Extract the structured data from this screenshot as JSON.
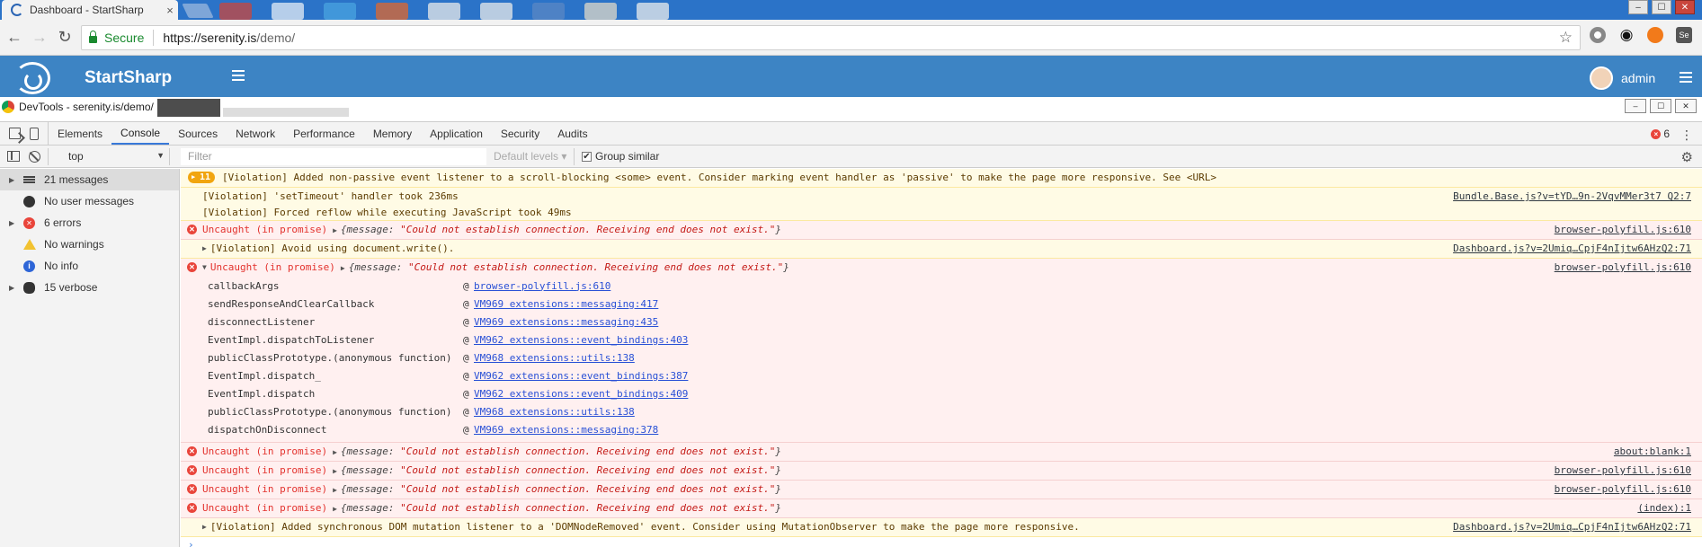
{
  "browser": {
    "tab_title": "Dashboard - StartSharp",
    "tab_close": "×",
    "url_secure": "Secure",
    "url_host": "https://serenity.is",
    "url_path": "/demo/",
    "bookmark_icon": "star-icon",
    "window_controls": [
      "‒",
      "☐",
      "✕"
    ]
  },
  "app": {
    "brand": "StartSharp",
    "user": "admin",
    "brand_color": "#3d84c4"
  },
  "devtools": {
    "title": "DevTools - serenity.is/demo/",
    "tabs": [
      "Elements",
      "Console",
      "Sources",
      "Network",
      "Performance",
      "Memory",
      "Application",
      "Security",
      "Audits"
    ],
    "active_tab": "Console",
    "error_count": "6",
    "context": "top",
    "filter_placeholder": "Filter",
    "levels": "Default levels ▾",
    "group_similar": "Group similar",
    "group_similar_checked": "✔"
  },
  "sidebar": {
    "items": [
      {
        "label": "21 messages",
        "icon": "list-icon",
        "expandable": true
      },
      {
        "label": "No user messages",
        "icon": "user-icon",
        "expandable": false
      },
      {
        "label": "6 errors",
        "icon": "error-icon",
        "expandable": true
      },
      {
        "label": "No warnings",
        "icon": "warning-icon",
        "expandable": false
      },
      {
        "label": "No info",
        "icon": "info-icon",
        "expandable": false
      },
      {
        "label": "15 verbose",
        "icon": "bug-icon",
        "expandable": true
      }
    ]
  },
  "console": {
    "m1": {
      "badge": "11",
      "text": "[Violation] Added non-passive event listener to a scroll-blocking <some> event. Consider marking event handler as 'passive' to make the page more responsive. See <URL>"
    },
    "m2": {
      "text": "[Violation] 'setTimeout' handler took 236ms",
      "src": "Bundle.Base.js?v=tYD…9n-2VqvMMer3t7 Q2:7"
    },
    "m3": {
      "text": "[Violation] Forced reflow while executing JavaScript took 49ms"
    },
    "m4": {
      "label": "Uncaught (in promise)",
      "obj_key": "{message: ",
      "obj_val": "\"Could not establish connection. Receiving end does not exist.\"",
      "obj_end": "}",
      "src": "browser-polyfill.js:610"
    },
    "m5": {
      "text": "[Violation] Avoid using document.write().",
      "src": "Dashboard.js?v=2Umiq…CpjF4nIjtw6AHzQ2:71"
    },
    "m6": {
      "label": "Uncaught (in promise)",
      "obj_key": "{message: ",
      "obj_val": "\"Could not establish connection. Receiving end does not exist.\"",
      "obj_end": "}",
      "src": "browser-polyfill.js:610",
      "frames": [
        {
          "fn": "callbackArgs",
          "at": "@",
          "link": "browser-polyfill.js:610"
        },
        {
          "fn": "sendResponseAndClearCallback",
          "at": "@",
          "link": "VM969 extensions::messaging:417"
        },
        {
          "fn": "disconnectListener",
          "at": "@",
          "link": "VM969 extensions::messaging:435"
        },
        {
          "fn": "EventImpl.dispatchToListener",
          "at": "@",
          "link": "VM962 extensions::event_bindings:403"
        },
        {
          "fn": "publicClassPrototype.(anonymous function)",
          "at": "@",
          "link": "VM968 extensions::utils:138"
        },
        {
          "fn": "EventImpl.dispatch_",
          "at": "@",
          "link": "VM962 extensions::event_bindings:387"
        },
        {
          "fn": "EventImpl.dispatch",
          "at": "@",
          "link": "VM962 extensions::event_bindings:409"
        },
        {
          "fn": "publicClassPrototype.(anonymous function)",
          "at": "@",
          "link": "VM968 extensions::utils:138"
        },
        {
          "fn": "dispatchOnDisconnect",
          "at": "@",
          "link": "VM969 extensions::messaging:378"
        }
      ]
    },
    "m7": {
      "label": "Uncaught (in promise)",
      "obj_key": "{message: ",
      "obj_val": "\"Could not establish connection. Receiving end does not exist.\"",
      "obj_end": "}",
      "src": "about:blank:1"
    },
    "m8": {
      "label": "Uncaught (in promise)",
      "obj_key": "{message: ",
      "obj_val": "\"Could not establish connection. Receiving end does not exist.\"",
      "obj_end": "}",
      "src": "browser-polyfill.js:610"
    },
    "m9": {
      "label": "Uncaught (in promise)",
      "obj_key": "{message: ",
      "obj_val": "\"Could not establish connection. Receiving end does not exist.\"",
      "obj_end": "}",
      "src": "browser-polyfill.js:610"
    },
    "m10": {
      "label": "Uncaught (in promise)",
      "obj_key": "{message: ",
      "obj_val": "\"Could not establish connection. Receiving end does not exist.\"",
      "obj_end": "}",
      "src": "(index):1"
    },
    "m11": {
      "text": "[Violation] Added synchronous DOM mutation listener to a 'DOMNodeRemoved' event. Consider using MutationObserver to make the page more responsive.",
      "src": "Dashboard.js?v=2Umiq…CpjF4nIjtw6AHzQ2:71"
    },
    "prompt": "›"
  }
}
